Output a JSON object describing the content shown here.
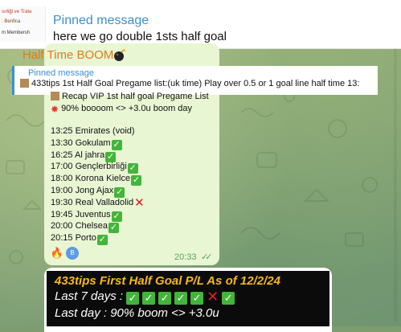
{
  "pinned_bar": {
    "title": "Pinned message",
    "text": "here we go double 1sts half goal",
    "thumb_lines": [
      "sırliği ve Tratə",
      ": Benfica",
      "m Membersh"
    ]
  },
  "message": {
    "title": "Half Time BOOM",
    "reply": {
      "label": "Pinned message",
      "text": "433tips 1st Half Goal Pregame list:(uk time) Play over 0.5 or 1 goal line half time   13:"
    },
    "recap": "Recap VIP 1st half goal Pregame List",
    "summary": "90% boooom <> +3.0u boom day",
    "matches": [
      {
        "text": "13:25 Emirates (void)",
        "result": ""
      },
      {
        "text": "13:30 Gokulam",
        "result": "win"
      },
      {
        "text": "16:25 Al jahra",
        "result": "win"
      },
      {
        "text": "17:00 Gençlerbirliği",
        "result": "win"
      },
      {
        "text": "18:00 Korona Kielce",
        "result": "win"
      },
      {
        "text": "19:00 Jong Ajax",
        "result": "win"
      },
      {
        "text": "19:30 Real Valladolid",
        "result": "loss"
      },
      {
        "text": "19:45 Juventus",
        "result": "win"
      },
      {
        "text": "20:00 Chelsea",
        "result": "win"
      },
      {
        "text": "20:15 Porto",
        "result": "win"
      }
    ],
    "time": "20:33",
    "reaction_avatar": "B"
  },
  "pl_card": {
    "title": "433tips First Half Goal P/L As of 12/2/24",
    "last7_label": "Last 7 days :",
    "last7_results": [
      "win",
      "win",
      "win",
      "win",
      "win",
      "loss",
      "win"
    ],
    "lastday": "Last day : 90% boom <> +3.0u"
  },
  "icons": {
    "win": "white-check-mark-icon",
    "loss": "red-cross-icon",
    "boom": "collision-icon",
    "bomb": "bomb-icon",
    "fire": "fire-icon",
    "read": "double-check-icon"
  }
}
